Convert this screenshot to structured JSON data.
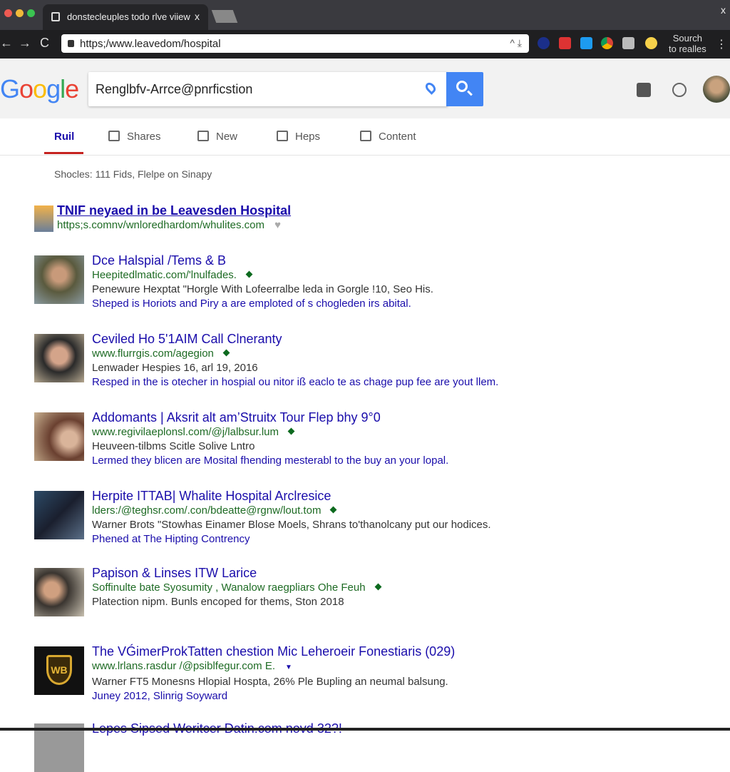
{
  "browser": {
    "tab_title": "donstecleuples todo rlve viiew",
    "tab_close": "x",
    "window_close": "x",
    "url": "https;/www.leavedom/hospital",
    "side_text_1": "Sourch",
    "side_text_2": "to realles",
    "nav": {
      "back": "←",
      "forward": "→",
      "reload": "C"
    }
  },
  "header": {
    "logo": "Google",
    "search_value": "Renglbfv-Arrce@pnrficstion"
  },
  "tabs": [
    {
      "label": "Ruil",
      "active": true
    },
    {
      "label": "Shares"
    },
    {
      "label": "New"
    },
    {
      "label": "Heps"
    },
    {
      "label": "Content"
    }
  ],
  "stats": "Shocles: 111 Fids, Flelpe on Sinapy",
  "results": [
    {
      "title": "TNIF neyaed in be Leavesden Hospital",
      "url": "https;s.comnv/wnloredhardom/whulites.com",
      "snippet": "",
      "snippet2": ""
    },
    {
      "title": "Dce Halspial /Tems & B",
      "url": "Heepitedlmatic.com/'lnulfades.",
      "snippet": "Penewure Hexptat \"Horgle With Lofeerralbe leda in Gorgle !10, Seo His.",
      "snippet2": "Sheped is Horiots and Piry a are emploted of s chogleden irs abital."
    },
    {
      "title": "Ceviled Ho 5'1AIM Call Clneranty",
      "url": "www.flurrgis.com/agegion",
      "snippet": "Lenwader Hespies 16, arl 19, 2016",
      "snippet2": "Resped in the is otecher in hospial ou nitor iß eaclo te as chage pup fee are yout llem."
    },
    {
      "title": "Addomants | Aksrit alt am’Struitx Tour Flep bhy 9°0",
      "url": "www.regivilaeplonsl.com/@j/lalbsur.lum",
      "snippet": "Heuveen-tilbms Scitle Solive Lntro",
      "snippet2": "Lermed they blicen are Mosital fhending mesterabl to the buy an your lopal."
    },
    {
      "title": "Herpite ITTAB| Whalite Hospital Arclresice",
      "url": "lders:/@teghsr.com/.con/bdeatte@rgnw/lout.tom",
      "snippet": "Warner Brots \"Stowhas Einamer Blose Moels, Shrans to'thanolcany put our hodices.",
      "snippet2": "Phened at The Hipting Contrency"
    },
    {
      "title": "Papison & Linses ITW Larice",
      "url": "Soffinulte bate Syosumity , Wanalow raegpliars Ohe Feuh",
      "snippet": "Platection nipm. Bunls encoped for thems, Ston 2018",
      "snippet2": ""
    },
    {
      "title": "The VǴimerProkTatten chestion Mic Leheroeir Fonestiaris (029)",
      "url": "www.lrlans.rasdur /@psiblfegur.com E.",
      "snippet": "Warner FT5 Monesns Hlopial Hospta, 26% Ple Bupling an neumal balsung.",
      "snippet2": "Juney 2012, Slinrig Soyward"
    },
    {
      "title": "Lepes Sipsed Weritcer Datin.com novd 32?!",
      "url": "",
      "snippet": "",
      "snippet2": ""
    }
  ],
  "colors": {
    "link": "#1a0dab",
    "url": "#1e6b24",
    "accent": "#4285f4",
    "tab_underline": "#c5221f"
  }
}
